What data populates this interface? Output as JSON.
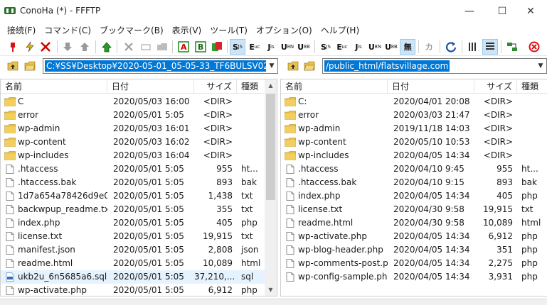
{
  "window": {
    "title": "ConoHa (*) - FFFTP"
  },
  "menu": [
    "接続(F)",
    "コマンド(C)",
    "ブックマーク(B)",
    "表示(V)",
    "ツール(T)",
    "オプション(O)",
    "ヘルプ(H)"
  ],
  "toolbar": {
    "ascii_label": "A",
    "binary_label": "B",
    "kana_sjis": "S",
    "kana_euc": "E",
    "kana_jis": "J",
    "kana_utf8n": "U",
    "kana_utf8": "U",
    "kana_sjis2": "S",
    "kana_euc2": "E",
    "kana_jis2": "J",
    "kana_utf8n2": "U",
    "kana_utf8b": "U",
    "no_conv": "無",
    "kana_conv": "カ"
  },
  "local": {
    "path": "C:¥SS¥Desktop¥2020-05-01_05-05-33_TF6BULSV02",
    "columns": {
      "name": "名前",
      "date": "日付",
      "size": "サイズ",
      "type": "種類"
    },
    "files": [
      {
        "name": "C",
        "date": "2020/05/03 16:00",
        "size": "<DIR>",
        "type": "",
        "icon": "folder"
      },
      {
        "name": "error",
        "date": "2020/05/01  5:05",
        "size": "<DIR>",
        "type": "",
        "icon": "folder"
      },
      {
        "name": "wp-admin",
        "date": "2020/05/03 16:01",
        "size": "<DIR>",
        "type": "",
        "icon": "folder"
      },
      {
        "name": "wp-content",
        "date": "2020/05/03 16:02",
        "size": "<DIR>",
        "type": "",
        "icon": "folder"
      },
      {
        "name": "wp-includes",
        "date": "2020/05/03 16:04",
        "size": "<DIR>",
        "type": "",
        "icon": "folder"
      },
      {
        "name": ".htaccess",
        "date": "2020/05/01  5:05",
        "size": "955",
        "type": "ht...",
        "icon": "file"
      },
      {
        "name": ".htaccess.bak",
        "date": "2020/05/01  5:05",
        "size": "893",
        "type": "bak",
        "icon": "file"
      },
      {
        "name": "1d7a654a78426d9e001...",
        "date": "2020/05/01  5:05",
        "size": "1,438",
        "type": "txt",
        "icon": "file"
      },
      {
        "name": "backwpup_readme.txt",
        "date": "2020/05/01  5:05",
        "size": "355",
        "type": "txt",
        "icon": "file"
      },
      {
        "name": "index.php",
        "date": "2020/05/01  5:05",
        "size": "405",
        "type": "php",
        "icon": "file"
      },
      {
        "name": "license.txt",
        "date": "2020/05/01  5:05",
        "size": "19,915",
        "type": "txt",
        "icon": "file"
      },
      {
        "name": "manifest.json",
        "date": "2020/05/01  5:05",
        "size": "2,808",
        "type": "json",
        "icon": "file"
      },
      {
        "name": "readme.html",
        "date": "2020/05/01  5:05",
        "size": "10,089",
        "type": "html",
        "icon": "file"
      },
      {
        "name": "ukb2u_6n5685a6.sql",
        "date": "2020/05/01  5:05",
        "size": "37,210,...",
        "type": "sql",
        "icon": "sqlfile",
        "selected": true
      },
      {
        "name": "wp-activate.php",
        "date": "2020/05/01  5:05",
        "size": "6,912",
        "type": "php",
        "icon": "file"
      }
    ]
  },
  "remote": {
    "path": "/public_html/flatsvillage.com",
    "columns": {
      "name": "名前",
      "date": "日付",
      "size": "サイズ",
      "type": "種類"
    },
    "files": [
      {
        "name": "C:",
        "date": "2020/04/01 20:08",
        "size": "<DIR>",
        "type": "",
        "icon": "folder"
      },
      {
        "name": "error",
        "date": "2020/03/03 21:47",
        "size": "<DIR>",
        "type": "",
        "icon": "folder"
      },
      {
        "name": "wp-admin",
        "date": "2019/11/18 14:03",
        "size": "<DIR>",
        "type": "",
        "icon": "folder"
      },
      {
        "name": "wp-content",
        "date": "2020/05/10 10:53",
        "size": "<DIR>",
        "type": "",
        "icon": "folder"
      },
      {
        "name": "wp-includes",
        "date": "2020/04/05 14:34",
        "size": "<DIR>",
        "type": "",
        "icon": "folder"
      },
      {
        "name": ".htaccess",
        "date": "2020/04/10  9:45",
        "size": "955",
        "type": "ht...",
        "icon": "file"
      },
      {
        "name": ".htaccess.bak",
        "date": "2020/04/10  9:15",
        "size": "893",
        "type": "bak",
        "icon": "file"
      },
      {
        "name": "index.php",
        "date": "2020/04/05 14:34",
        "size": "405",
        "type": "php",
        "icon": "file"
      },
      {
        "name": "license.txt",
        "date": "2020/04/30  9:58",
        "size": "19,915",
        "type": "txt",
        "icon": "file"
      },
      {
        "name": "readme.html",
        "date": "2020/04/30  9:58",
        "size": "10,089",
        "type": "html",
        "icon": "file"
      },
      {
        "name": "wp-activate.php",
        "date": "2020/04/05 14:34",
        "size": "6,912",
        "type": "php",
        "icon": "file"
      },
      {
        "name": "wp-blog-header.php",
        "date": "2020/04/05 14:34",
        "size": "351",
        "type": "php",
        "icon": "file"
      },
      {
        "name": "wp-comments-post.p...",
        "date": "2020/04/05 14:34",
        "size": "2,275",
        "type": "php",
        "icon": "file"
      },
      {
        "name": "wp-config-sample.php",
        "date": "2020/04/05 14:34",
        "size": "3,931",
        "type": "php",
        "icon": "file"
      }
    ]
  },
  "colors": {
    "selection": "#0078d7",
    "folder": "#e8c04a",
    "row_highlight": "#e5f3ff"
  }
}
